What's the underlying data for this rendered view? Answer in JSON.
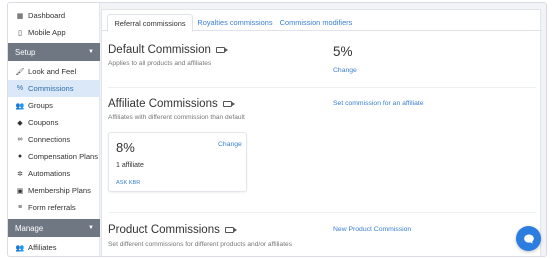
{
  "sidebar": {
    "top_items": [
      {
        "label": "Dashboard",
        "icon": "dashboard-icon"
      },
      {
        "label": "Mobile App",
        "icon": "mobile-icon"
      }
    ],
    "setup_header": "Setup",
    "setup_items": [
      {
        "label": "Look and Feel",
        "icon": "paint-roller-icon"
      },
      {
        "label": "Commissions",
        "icon": "percent-icon",
        "active": true
      },
      {
        "label": "Groups",
        "icon": "users-icon"
      },
      {
        "label": "Coupons",
        "icon": "tag-icon"
      },
      {
        "label": "Connections",
        "icon": "link-icon"
      },
      {
        "label": "Compensation Plans",
        "icon": "dollar-circle-icon"
      },
      {
        "label": "Automations",
        "icon": "gear-icon"
      },
      {
        "label": "Membership Plans",
        "icon": "id-card-icon"
      },
      {
        "label": "Form referrals",
        "icon": "list-icon"
      }
    ],
    "manage_header": "Manage",
    "manage_items": [
      {
        "label": "Affiliates",
        "icon": "users-icon"
      }
    ]
  },
  "tabs": [
    {
      "label": "Referral commissions",
      "active": true
    },
    {
      "label": "Royalties commissions"
    },
    {
      "label": "Commission modifiers"
    }
  ],
  "default_commission": {
    "title": "Default Commission",
    "subtitle": "Applies to all products and affiliates",
    "value": "5%",
    "change_label": "Change"
  },
  "affiliate_commissions": {
    "title": "Affiliate Commissions",
    "subtitle": "Affiliates with different commission than default",
    "action_label": "Set commission for an affiliate",
    "card": {
      "value": "8%",
      "change_label": "Change",
      "count_text": "1 affiliate",
      "affiliate_name": "ASK KBR"
    }
  },
  "product_commissions": {
    "title": "Product Commissions",
    "subtitle": "Set different commissions for different products and/or affiliates",
    "action_label": "New Product Commission"
  },
  "colors": {
    "accent": "#3a7fd0",
    "active_bg": "#dbe8f7",
    "section_header_bg": "#6f7782",
    "chat_button": "#2b7de0"
  }
}
